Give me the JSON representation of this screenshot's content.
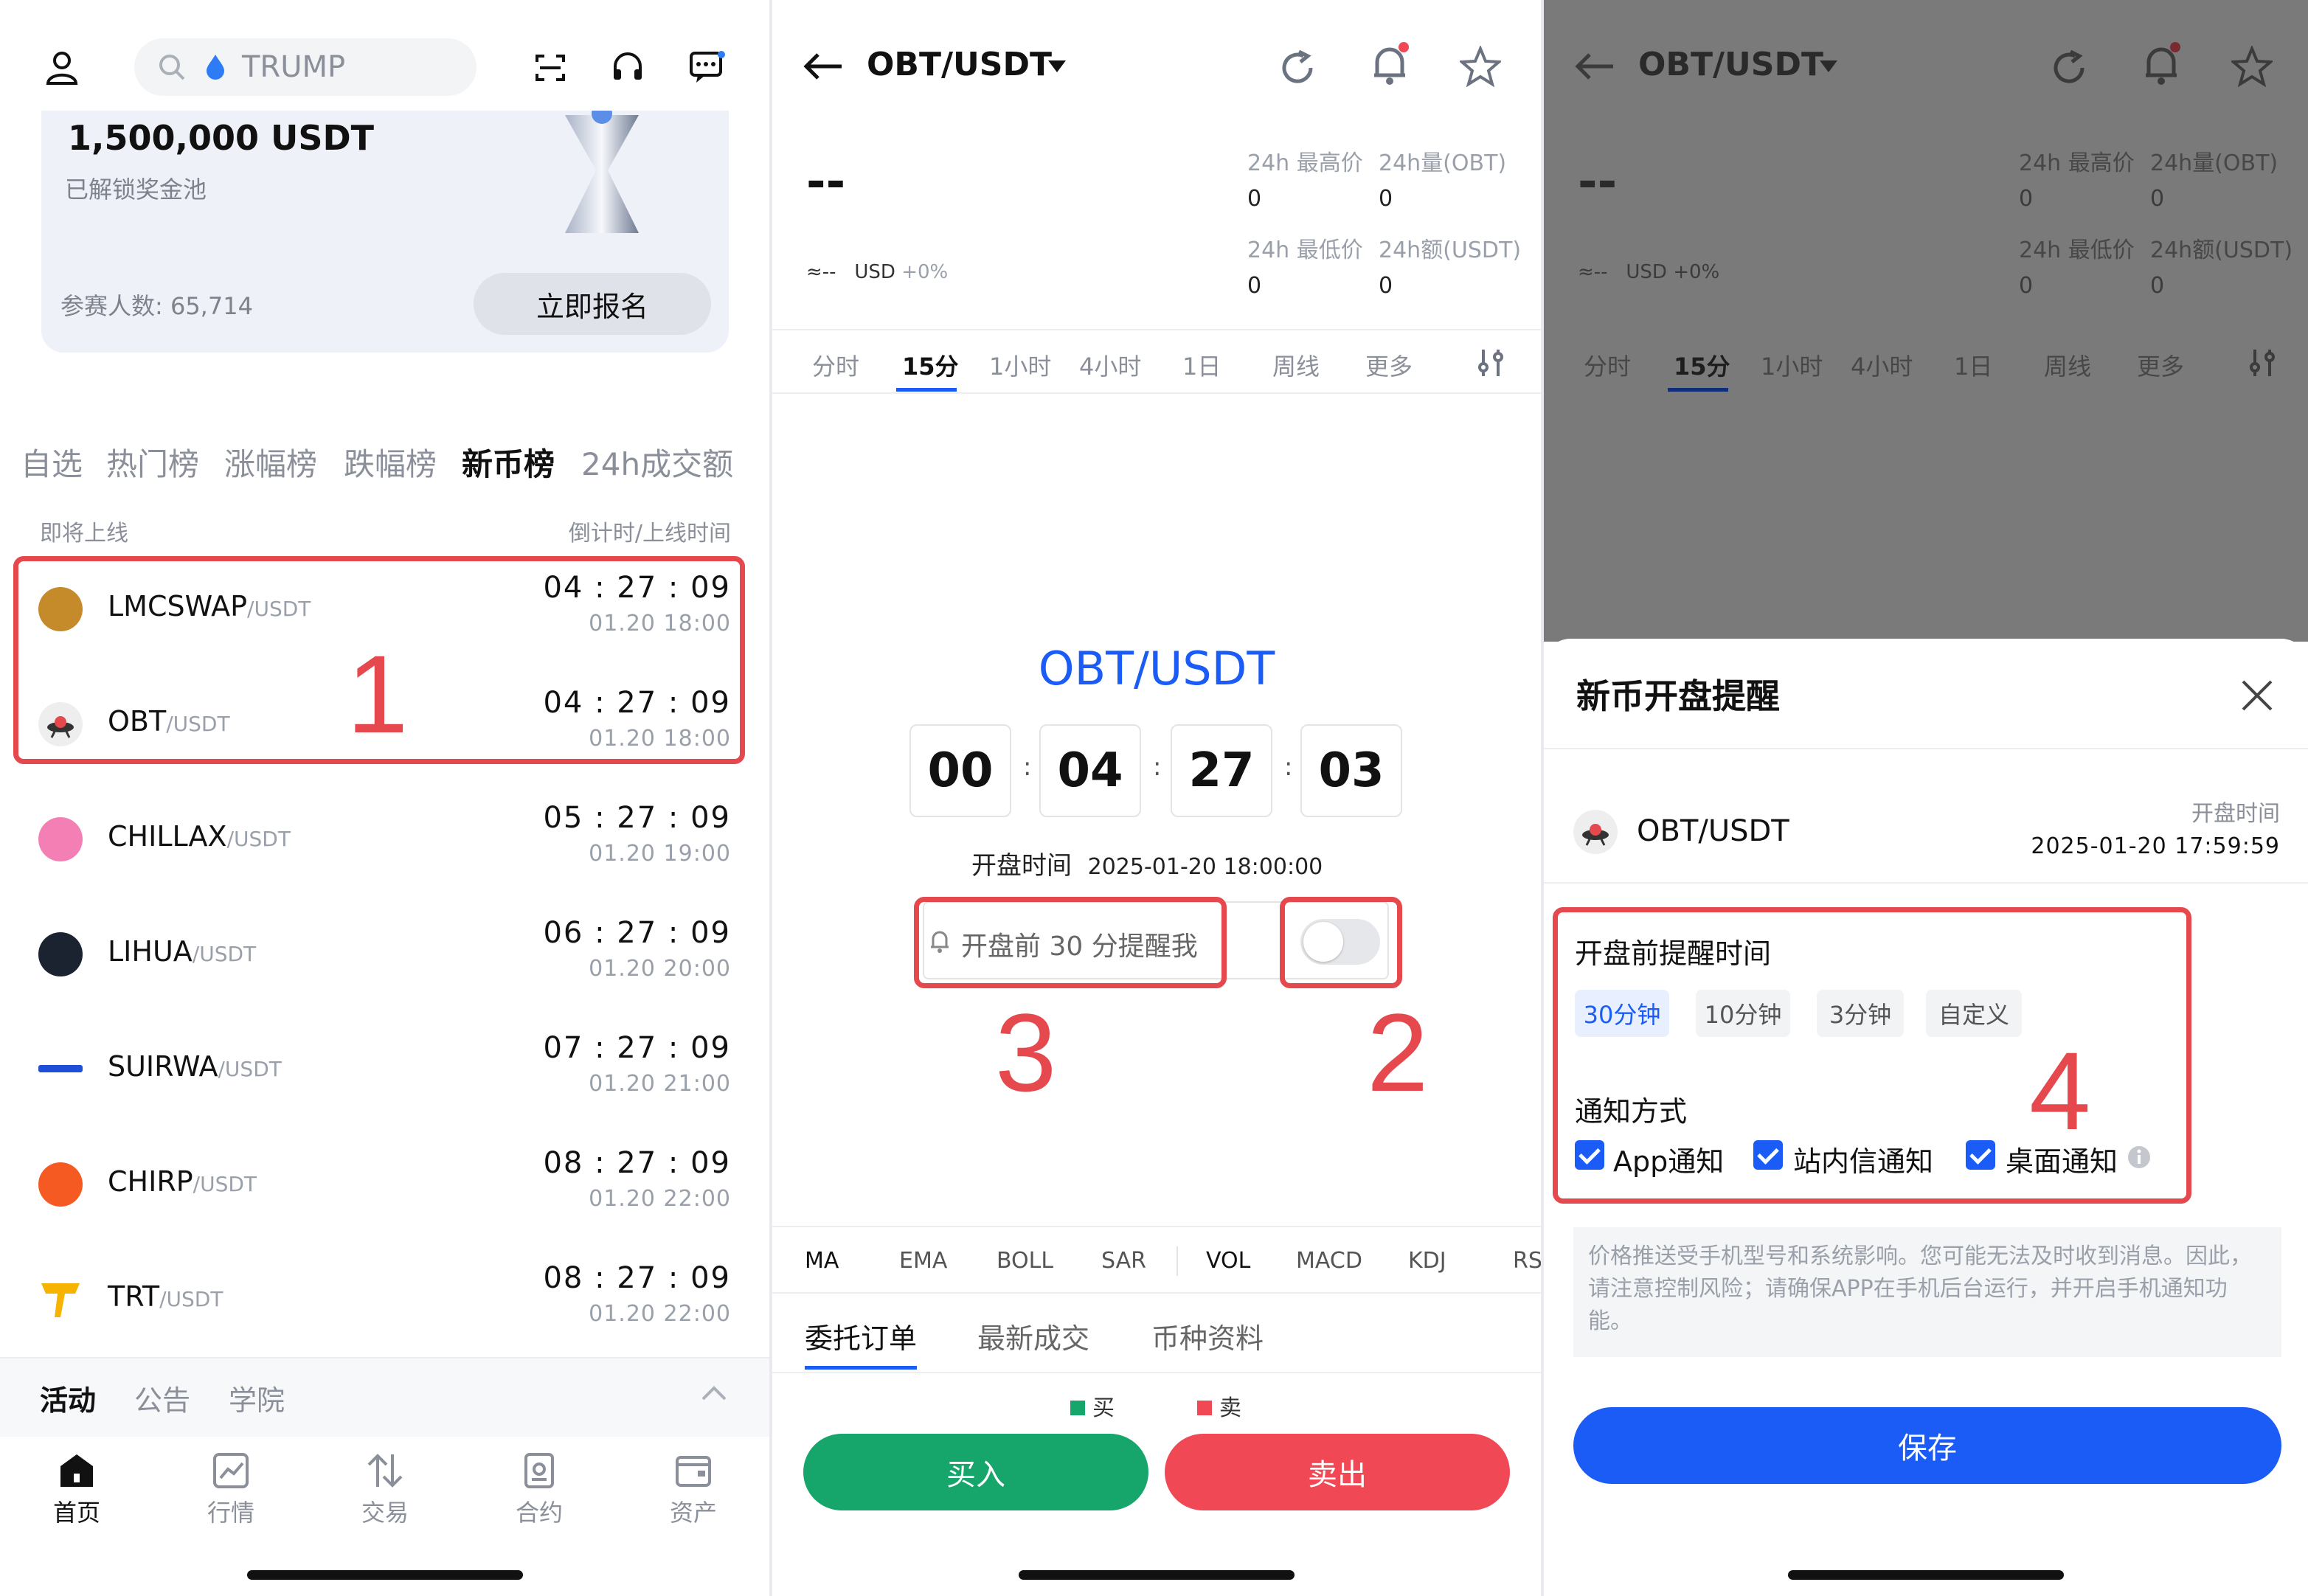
{
  "panel1": {
    "search_placeholder": "TRUMP",
    "prize_amount": "1,500,000 USDT",
    "prize_caption": "已解锁奖金池",
    "participants": "参赛人数: 65,714",
    "enroll_label": "立即报名",
    "tabs": [
      "自选",
      "热门榜",
      "涨幅榜",
      "跌幅榜",
      "新币榜",
      "24h成交额"
    ],
    "active_tab": "新币榜",
    "list_header_left": "即将上线",
    "list_header_right": "倒计时/上线时间",
    "coins": [
      {
        "name": "LMCSWAP",
        "pair": "/USDT",
        "countdown": "04 : 27 : 09",
        "date": "01.20 18:00",
        "color": "#c58b2b"
      },
      {
        "name": "OBT",
        "pair": "/USDT",
        "countdown": "04 : 27 : 09",
        "date": "01.20 18:00",
        "color": "#eeeeee"
      },
      {
        "name": "CHILLAX",
        "pair": "/USDT",
        "countdown": "05 : 27 : 09",
        "date": "01.20 19:00",
        "color": "#f47fb4"
      },
      {
        "name": "LIHUA",
        "pair": "/USDT",
        "countdown": "06 : 27 : 09",
        "date": "01.20 20:00",
        "color": "#1b2330"
      },
      {
        "name": "SUIRWA",
        "pair": "/USDT",
        "countdown": "07 : 27 : 09",
        "date": "01.20 21:00",
        "color": "#1f4fd6"
      },
      {
        "name": "CHIRP",
        "pair": "/USDT",
        "countdown": "08 : 27 : 09",
        "date": "01.20 22:00",
        "color": "#f45a22"
      },
      {
        "name": "TRT",
        "pair": "/USDT",
        "countdown": "08 : 27 : 09",
        "date": "01.20 22:00",
        "color": "#f6b400"
      }
    ],
    "footer_tabs": [
      "活动",
      "公告",
      "学院"
    ],
    "nav": [
      "首页",
      "行情",
      "交易",
      "合约",
      "资产"
    ],
    "annotation": "1"
  },
  "panel2": {
    "pair_title": "OBT/USDT",
    "last_price": "--",
    "approx": "≈--",
    "usd_label": "USD",
    "change": "+0%",
    "stats": {
      "high_label": "24h 最高价",
      "high_value": "0",
      "vol_label": "24h量(OBT)",
      "vol_value": "0",
      "low_label": "24h 最低价",
      "low_value": "0",
      "amt_label": "24h额(USDT)",
      "amt_value": "0"
    },
    "timeframes": [
      "分时",
      "15分",
      "1小时",
      "4小时",
      "1日",
      "周线",
      "更多"
    ],
    "active_timeframe": "15分",
    "center_pair": "OBT/USDT",
    "countdown": [
      "00",
      "04",
      "27",
      "03"
    ],
    "open_time_label": "开盘时间",
    "open_time_value": "2025-01-20 18:00:00",
    "remind_label": "开盘前 30 分提醒我",
    "indicators": [
      "MA",
      "EMA",
      "BOLL",
      "SAR",
      "VOL",
      "MACD",
      "KDJ",
      "RS"
    ],
    "bottom_tabs": [
      "委托订单",
      "最新成交",
      "币种资料"
    ],
    "legend_buy": "买",
    "legend_sell": "卖",
    "buy_label": "买入",
    "sell_label": "卖出",
    "annotation_left": "3",
    "annotation_right": "2",
    "colors": {
      "blue": "#1a5cf5",
      "green": "#16a56a",
      "red": "#f04955"
    }
  },
  "panel3": {
    "pair_title": "OBT/USDT",
    "last_price": "--",
    "approx": "≈--",
    "usd_label": "USD",
    "change": "+0%",
    "stats": {
      "high_label": "24h 最高价",
      "high_value": "0",
      "vol_label": "24h量(OBT)",
      "vol_value": "0",
      "low_label": "24h 最低价",
      "low_value": "0",
      "amt_label": "24h额(USDT)",
      "amt_value": "0"
    },
    "timeframes": [
      "分时",
      "15分",
      "1小时",
      "4小时",
      "1日",
      "周线",
      "更多"
    ],
    "sheet_title": "新币开盘提醒",
    "sheet_pair": "OBT/USDT",
    "open_time_label": "开盘时间",
    "open_time_value": "2025-01-20 17:59:59",
    "remind_time_label": "开盘前提醒时间",
    "chips": [
      "30分钟",
      "10分钟",
      "3分钟",
      "自定义"
    ],
    "notify_label": "通知方式",
    "notify_options": [
      "App通知",
      "站内信通知",
      "桌面通知"
    ],
    "notice": "价格推送受手机型号和系统影响。您可能无法及时收到消息。因此，请注意控制风险；请确保APP在手机后台运行，并开启手机通知功能。",
    "save_label": "保存",
    "annotation": "4"
  }
}
